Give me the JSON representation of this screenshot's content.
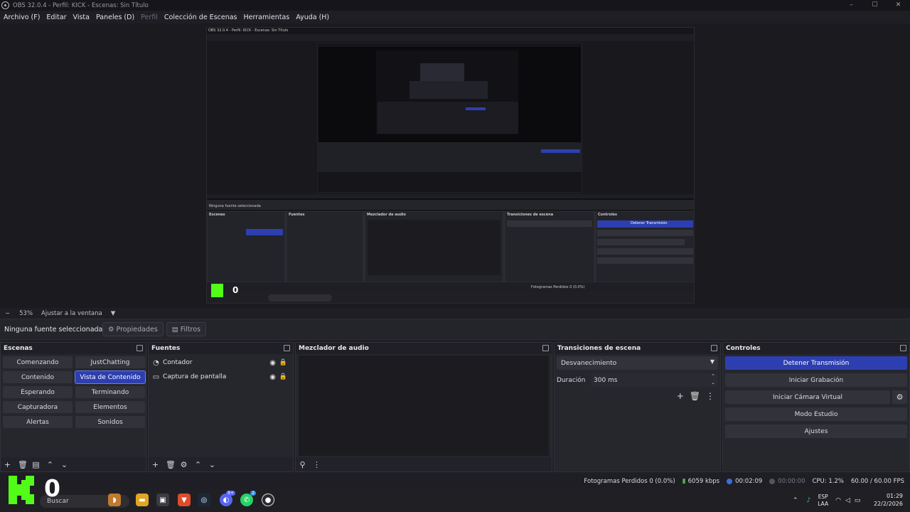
{
  "window": {
    "title": "OBS 32.0.4 - Perfil: KICK - Escenas: Sin Título",
    "controls": [
      "–",
      "☐",
      "✕"
    ]
  },
  "menu": {
    "items": [
      "Archivo (F)",
      "Editar",
      "Vista",
      "Paneles (D)",
      "Perfil",
      "Colección de Escenas",
      "Herramientas",
      "Ayuda (H)"
    ]
  },
  "zoom": {
    "minus": "−",
    "level": "53%",
    "fit": "Ajustar a la ventana"
  },
  "source_toolbar": {
    "no_source": "Ninguna fuente seleccionada",
    "properties": "Propiedades",
    "filters": "Filtros"
  },
  "scenes": {
    "title": "Escenas",
    "items": [
      "Comenzando",
      "JustChatting",
      "Contenido",
      "Vista de Contenido",
      "Esperando",
      "Terminando",
      "Capturadora",
      "Elementos",
      "Alertas",
      "Sonidos"
    ],
    "active": "Vista de Contenido"
  },
  "sources": {
    "title": "Fuentes",
    "items": [
      {
        "label": "Contador",
        "icon": "clock-icon"
      },
      {
        "label": "Captura de pantalla",
        "icon": "monitor-icon"
      }
    ]
  },
  "mixer": {
    "title": "Mezclador de audio"
  },
  "transitions": {
    "title": "Transiciones de escena",
    "selected": "Desvanecimiento",
    "duration_label": "Duración",
    "duration_value": "300 ms"
  },
  "controls": {
    "title": "Controles",
    "stop_stream": "Detener Transmisión",
    "start_recording": "Iniciar Grabación",
    "start_virtual_cam": "Iniciar Cámara Virtual",
    "studio_mode": "Modo Estudio",
    "settings": "Ajustes"
  },
  "status": {
    "dropped_frames": "Fotogramas Perdidos 0 (0.0%)",
    "bitrate": "6059 kbps",
    "stream_time": "00:02:09",
    "rec_time": "00:00:00",
    "cpu": "CPU: 1.2%",
    "fps": "60.00 / 60.00 FPS"
  },
  "overlay": {
    "counter": "0",
    "brand_color": "#53fc18"
  },
  "taskbar": {
    "search_placeholder": "Buscar",
    "lang_top": "ESP",
    "lang_bottom": "LAA",
    "time": "01:29",
    "date": "22/2/2026",
    "badge_discord": "9+",
    "badge_whatsapp": "2"
  },
  "colors": {
    "accent": "#2d3fb0",
    "background": "#1e1e24",
    "panel": "#26262d"
  }
}
